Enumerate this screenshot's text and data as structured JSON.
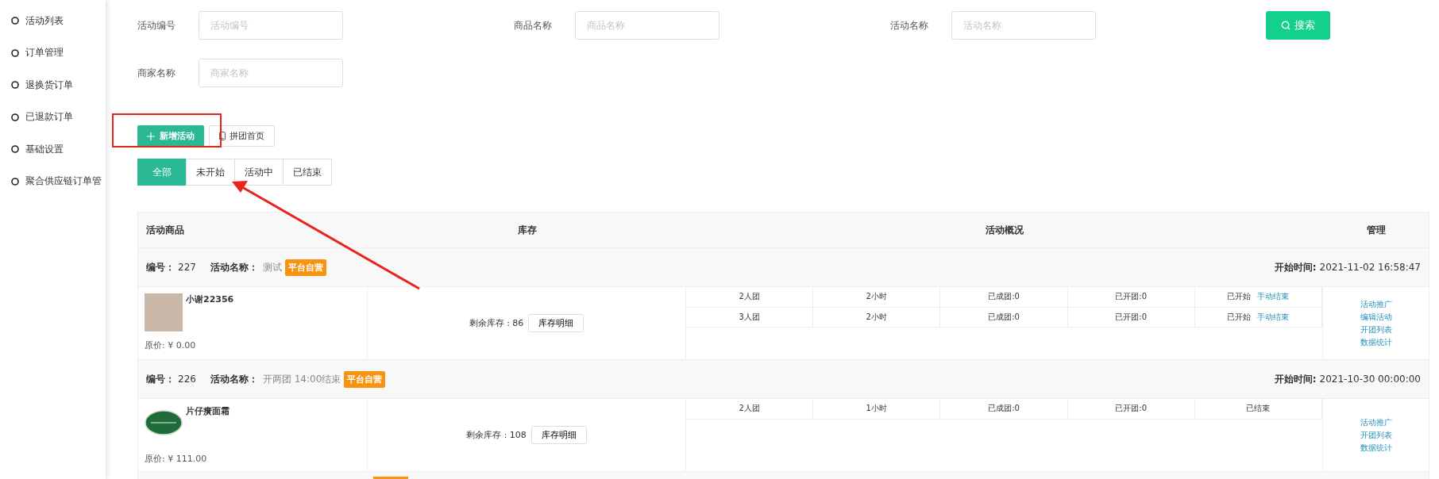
{
  "sidebar": {
    "items": [
      {
        "label": "活动列表"
      },
      {
        "label": "订单管理"
      },
      {
        "label": "退换货订单"
      },
      {
        "label": "已退款订单"
      },
      {
        "label": "基础设置"
      },
      {
        "label": "聚合供应链订单管"
      }
    ]
  },
  "filters": [
    {
      "label": "活动编号",
      "placeholder": "活动编号"
    },
    {
      "label": "商品名称",
      "placeholder": "商品名称"
    },
    {
      "label": "活动名称",
      "placeholder": "活动名称"
    },
    {
      "label": "商家名称",
      "placeholder": "商家名称"
    }
  ],
  "search_button": "搜索",
  "toolbar": {
    "add_button": "新增活动",
    "home_button": "拼团首页"
  },
  "tabs": [
    {
      "label": "全部",
      "selected": true
    },
    {
      "label": "未开始",
      "selected": false
    },
    {
      "label": "活动中",
      "selected": false
    },
    {
      "label": "已结束",
      "selected": false
    }
  ],
  "table": {
    "columns": [
      "活动商品",
      "库存",
      "活动概况",
      "管理"
    ],
    "groups": [
      {
        "id_label": "编号：",
        "id": "227",
        "name_label": "活动名称：",
        "name": "测试",
        "badge": "平台自营",
        "start_label": "开始时间:",
        "start": "2021-11-02 16:58:47",
        "product": {
          "kind": "photo",
          "name": "小谢22356",
          "price": "原价: ¥ 0.00"
        },
        "stock": {
          "text": "剩余库存 : 86",
          "button": "库存明细"
        },
        "tiers": [
          {
            "size": "2人团",
            "duration": "2小时",
            "formed": "已成团:0",
            "opened": "已开团:0",
            "status": "已开始",
            "action": "手动结束"
          },
          {
            "size": "3人团",
            "duration": "2小时",
            "formed": "已成团:0",
            "opened": "已开团:0",
            "status": "已开始",
            "action": "手动结束"
          }
        ],
        "actions": [
          "活动推广",
          "编辑活动",
          "开团列表",
          "数据统计"
        ]
      },
      {
        "id_label": "编号：",
        "id": "226",
        "name_label": "活动名称：",
        "name": "开两团 14:00结束",
        "badge": "平台自营",
        "start_label": "开始时间:",
        "start": "2021-10-30 00:00:00",
        "product": {
          "kind": "oval-logo",
          "name": "片仔癀面霜",
          "price": "原价: ¥ 111.00"
        },
        "stock": {
          "text": "剩余库存 : 108",
          "button": "库存明细"
        },
        "tiers": [
          {
            "size": "2人团",
            "duration": "1小时",
            "formed": "已成团:0",
            "opened": "已开团:0",
            "status": "已结束"
          }
        ],
        "actions": [
          "活动推广",
          "开团列表",
          "数据统计"
        ]
      }
    ],
    "more_below": true
  }
}
